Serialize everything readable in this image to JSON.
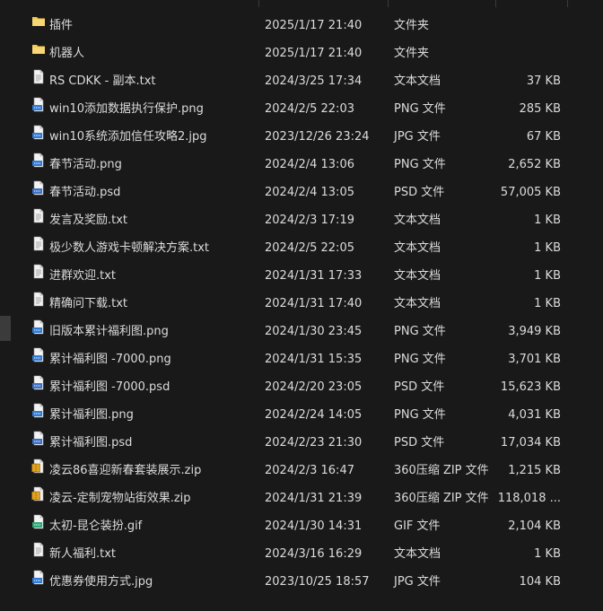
{
  "files": [
    {
      "name": "插件",
      "date": "2025/1/17 21:40",
      "type": "文件夹",
      "size": "",
      "icon": "folder-icon"
    },
    {
      "name": "机器人",
      "date": "2025/1/17 21:40",
      "type": "文件夹",
      "size": "",
      "icon": "folder-icon"
    },
    {
      "name": "RS CDKK - 副本.txt",
      "date": "2024/3/25 17:34",
      "type": "文本文档",
      "size": "37 KB",
      "icon": "text-file-icon"
    },
    {
      "name": "win10添加数据执行保护.png",
      "date": "2024/2/5 22:03",
      "type": "PNG 文件",
      "size": "285 KB",
      "icon": "png-file-icon"
    },
    {
      "name": "win10系统添加信任攻略2.jpg",
      "date": "2023/12/26 23:24",
      "type": "JPG 文件",
      "size": "67 KB",
      "icon": "jpg-file-icon"
    },
    {
      "name": "春节活动.png",
      "date": "2024/2/4 13:06",
      "type": "PNG 文件",
      "size": "2,652 KB",
      "icon": "png-file-icon"
    },
    {
      "name": "春节活动.psd",
      "date": "2024/2/4 13:05",
      "type": "PSD 文件",
      "size": "57,005 KB",
      "icon": "psd-file-icon"
    },
    {
      "name": "发言及奖励.txt",
      "date": "2024/2/3 17:19",
      "type": "文本文档",
      "size": "1 KB",
      "icon": "text-file-icon"
    },
    {
      "name": "极少数人游戏卡顿解决方案.txt",
      "date": "2024/2/5 22:05",
      "type": "文本文档",
      "size": "1 KB",
      "icon": "text-file-icon"
    },
    {
      "name": "进群欢迎.txt",
      "date": "2024/1/31 17:33",
      "type": "文本文档",
      "size": "1 KB",
      "icon": "text-file-icon"
    },
    {
      "name": "精确问下载.txt",
      "date": "2024/1/31 17:40",
      "type": "文本文档",
      "size": "1 KB",
      "icon": "text-file-icon"
    },
    {
      "name": "旧版本累计福利图.png",
      "date": "2024/1/30 23:45",
      "type": "PNG 文件",
      "size": "3,949 KB",
      "icon": "png-file-icon"
    },
    {
      "name": "累计福利图 -7000.png",
      "date": "2024/1/31 15:35",
      "type": "PNG 文件",
      "size": "3,701 KB",
      "icon": "png-file-icon"
    },
    {
      "name": "累计福利图 -7000.psd",
      "date": "2024/2/20 23:05",
      "type": "PSD 文件",
      "size": "15,623 KB",
      "icon": "psd-file-icon"
    },
    {
      "name": "累计福利图.png",
      "date": "2024/2/24 14:05",
      "type": "PNG 文件",
      "size": "4,031 KB",
      "icon": "png-file-icon"
    },
    {
      "name": "累计福利图.psd",
      "date": "2024/2/23 21:30",
      "type": "PSD 文件",
      "size": "17,034 KB",
      "icon": "psd-file-icon"
    },
    {
      "name": "凌云86喜迎新春套装展示.zip",
      "date": "2024/2/3 16:47",
      "type": "360压缩 ZIP 文件",
      "size": "1,215 KB",
      "icon": "zip-archive-icon"
    },
    {
      "name": "凌云-定制宠物站街效果.zip",
      "date": "2024/1/31 21:39",
      "type": "360压缩 ZIP 文件",
      "size": "118,018 ...",
      "icon": "zip-archive-icon"
    },
    {
      "name": "太初-昆仑装扮.gif",
      "date": "2024/1/30 14:31",
      "type": "GIF 文件",
      "size": "2,104 KB",
      "icon": "gif-file-icon"
    },
    {
      "name": "新人福利.txt",
      "date": "2024/3/16 16:29",
      "type": "文本文档",
      "size": "1 KB",
      "icon": "text-file-icon"
    },
    {
      "name": "优惠券使用方式.jpg",
      "date": "2023/10/25 18:57",
      "type": "JPG 文件",
      "size": "104 KB",
      "icon": "jpg-file-icon"
    }
  ],
  "colors": {
    "background": "#191919",
    "text": "#dcdcdc",
    "folder": "#f2c94c",
    "file_page": "#f3f3f3",
    "image_badge": "#2f7bd8",
    "psd_badge": "#3b6fc9",
    "gif_badge": "#2aa876",
    "zip_badge": "#e0a321"
  }
}
